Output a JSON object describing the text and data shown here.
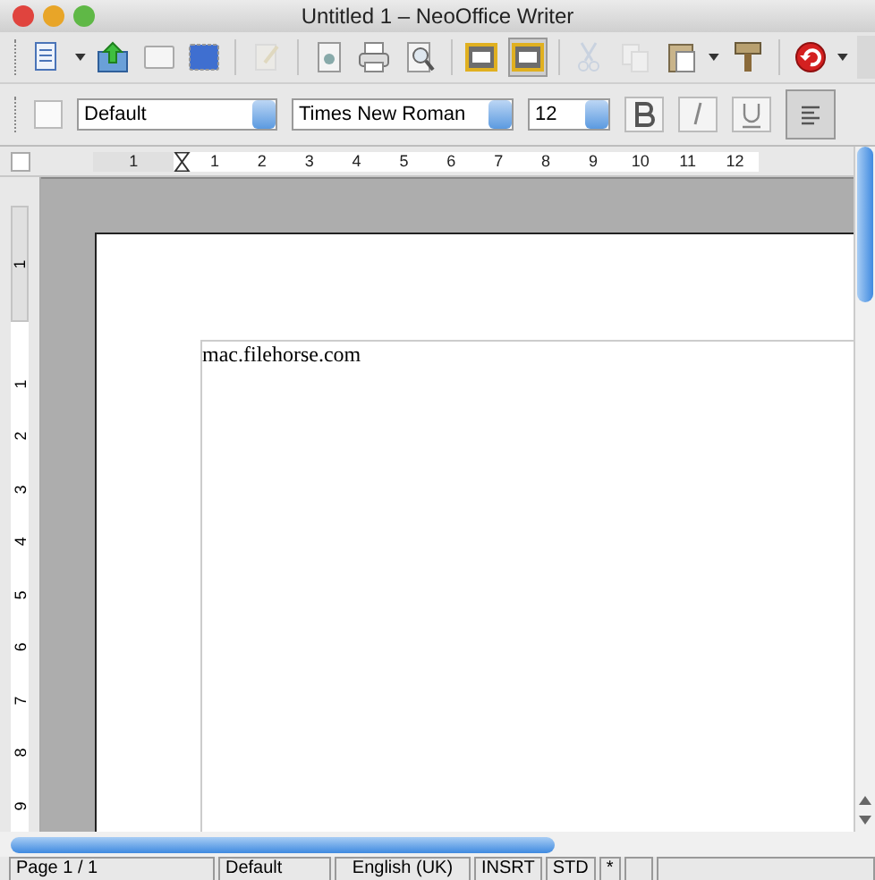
{
  "window": {
    "title": "Untitled 1 – NeoOffice Writer"
  },
  "toolbar": [
    {
      "kind": "new",
      "disabled": false,
      "selected": false,
      "dropdown": true
    },
    {
      "kind": "open",
      "disabled": false,
      "selected": false,
      "dropdown": false
    },
    {
      "kind": "blank",
      "disabled": false,
      "selected": false,
      "dropdown": false
    },
    {
      "kind": "frame",
      "disabled": false,
      "selected": false,
      "dropdown": false
    },
    {
      "kind": "separator"
    },
    {
      "kind": "edit",
      "disabled": true,
      "selected": false,
      "dropdown": false
    },
    {
      "kind": "separator"
    },
    {
      "kind": "pdf",
      "disabled": false,
      "selected": false,
      "dropdown": false
    },
    {
      "kind": "print",
      "disabled": false,
      "selected": false,
      "dropdown": false
    },
    {
      "kind": "preview",
      "disabled": false,
      "selected": false,
      "dropdown": false
    },
    {
      "kind": "separator"
    },
    {
      "kind": "field",
      "disabled": false,
      "selected": false,
      "dropdown": false
    },
    {
      "kind": "field",
      "disabled": false,
      "selected": true,
      "dropdown": false
    },
    {
      "kind": "separator"
    },
    {
      "kind": "cut",
      "disabled": true,
      "selected": false,
      "dropdown": false
    },
    {
      "kind": "copy",
      "disabled": true,
      "selected": false,
      "dropdown": false
    },
    {
      "kind": "paste",
      "disabled": false,
      "selected": false,
      "dropdown": true
    },
    {
      "kind": "brush",
      "disabled": false,
      "selected": false,
      "dropdown": false
    },
    {
      "kind": "separator"
    },
    {
      "kind": "undo",
      "disabled": false,
      "selected": false,
      "dropdown": true
    }
  ],
  "format_bar": {
    "style": "Default",
    "font": "Times New Roman",
    "size": "12",
    "buttons": [
      {
        "kind": "bold",
        "selected": false
      },
      {
        "kind": "italic",
        "selected": false
      },
      {
        "kind": "underline",
        "selected": false
      },
      {
        "kind": "align-left",
        "selected": true
      }
    ]
  },
  "ruler": {
    "left_labels": [
      "1"
    ],
    "labels": [
      "1",
      "2",
      "3",
      "4",
      "5",
      "6",
      "7",
      "8",
      "9",
      "10",
      "11",
      "12"
    ]
  },
  "vertical_ruler": {
    "top_labels": [
      "1"
    ],
    "labels": [
      "1",
      "2",
      "3",
      "4",
      "5",
      "6",
      "7",
      "8",
      "9"
    ]
  },
  "document": {
    "text": "mac.filehorse.com"
  },
  "status_bar": [
    "Page 1 / 1",
    "Default",
    "English (UK)",
    "INSRT",
    "STD",
    "*"
  ]
}
